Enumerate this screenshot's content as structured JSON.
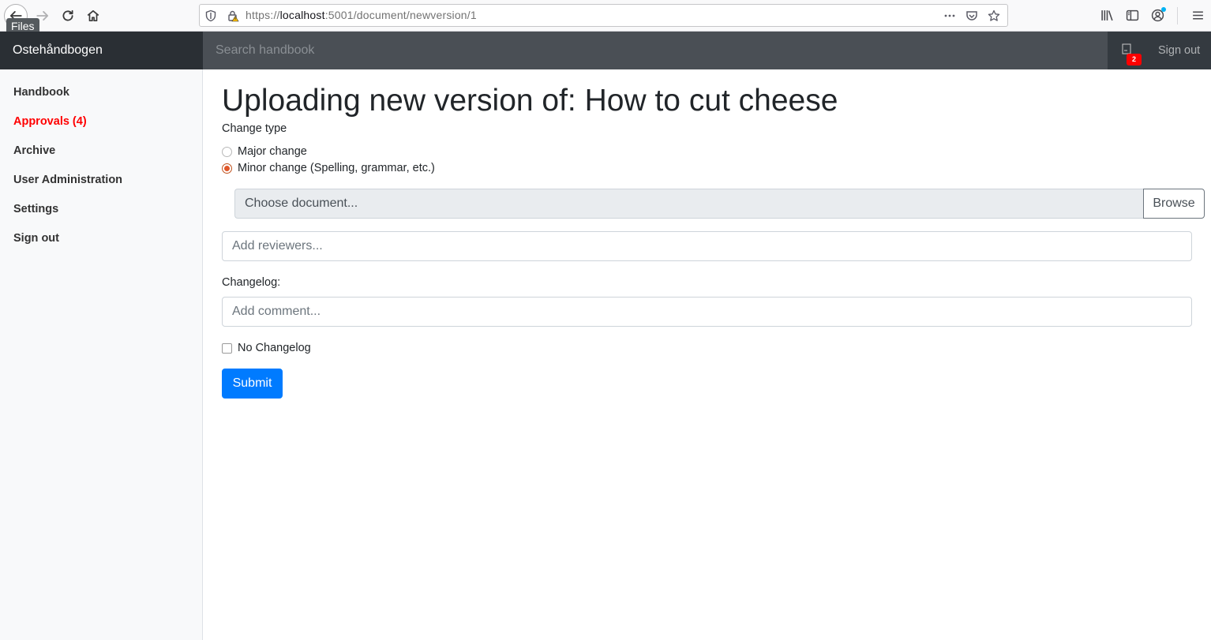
{
  "browser": {
    "tooltip": "Files",
    "url_scheme": "https://",
    "url_host": "localhost",
    "url_rest": ":5001/document/newversion/1",
    "icons": [
      "back-icon",
      "forward-icon",
      "reload-icon",
      "home-icon",
      "shield-icon",
      "insecure-lock-icon",
      "more-icon",
      "pocket-icon",
      "bookmark-star-icon",
      "library-icon",
      "sidebar-icon",
      "account-icon",
      "menu-icon"
    ]
  },
  "navbar": {
    "brand": "Ostehåndbogen",
    "search_placeholder": "Search handbook",
    "notification_count": "2",
    "sign_out": "Sign out"
  },
  "sidebar": {
    "items": [
      {
        "label": "Handbook"
      },
      {
        "label": "Approvals (4)"
      },
      {
        "label": "Archive"
      },
      {
        "label": "User Administration"
      },
      {
        "label": "Settings"
      },
      {
        "label": "Sign out"
      }
    ],
    "active_color": "#ff0000"
  },
  "main": {
    "title": "Uploading new version of: How to cut cheese",
    "change_type_label": "Change type",
    "options": [
      {
        "label": "Major change",
        "checked": false
      },
      {
        "label": "Minor change (Spelling, grammar, etc.)",
        "checked": true
      }
    ],
    "file_placeholder": "Choose document...",
    "browse_label": "Browse",
    "reviewers_placeholder": "Add reviewers...",
    "changelog_label": "Changelog:",
    "comment_placeholder": "Add comment...",
    "no_changelog_label": "No Changelog",
    "no_changelog_checked": false,
    "submit_label": "Submit"
  },
  "colors": {
    "navbar_bg": "#343a40",
    "primary": "#007bff",
    "accent_radio": "#e0572a"
  }
}
